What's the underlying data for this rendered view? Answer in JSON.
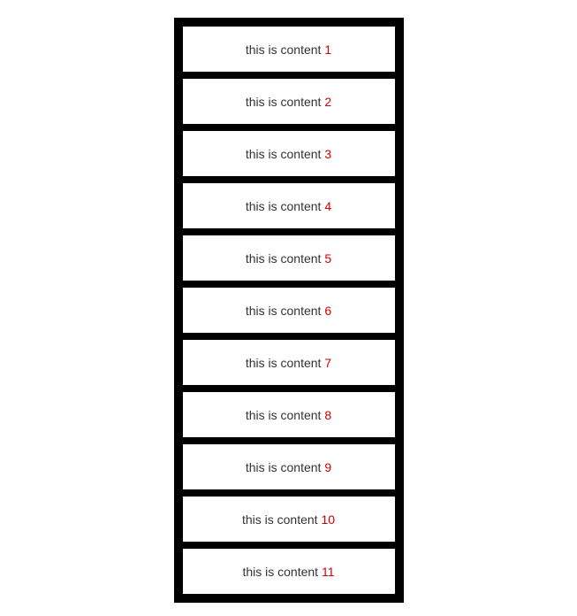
{
  "items": [
    {
      "id": 1,
      "label": "this is content ",
      "num": "1"
    },
    {
      "id": 2,
      "label": "this is content ",
      "num": "2"
    },
    {
      "id": 3,
      "label": "this is content ",
      "num": "3"
    },
    {
      "id": 4,
      "label": "this is content ",
      "num": "4"
    },
    {
      "id": 5,
      "label": "this is content ",
      "num": "5"
    },
    {
      "id": 6,
      "label": "this is content ",
      "num": "6"
    },
    {
      "id": 7,
      "label": "this is content ",
      "num": "7"
    },
    {
      "id": 8,
      "label": "this is content ",
      "num": "8"
    },
    {
      "id": 9,
      "label": "this is content ",
      "num": "9"
    },
    {
      "id": 10,
      "label": "this is content ",
      "num": "10"
    },
    {
      "id": 11,
      "label": "this is content ",
      "num": "11"
    }
  ]
}
